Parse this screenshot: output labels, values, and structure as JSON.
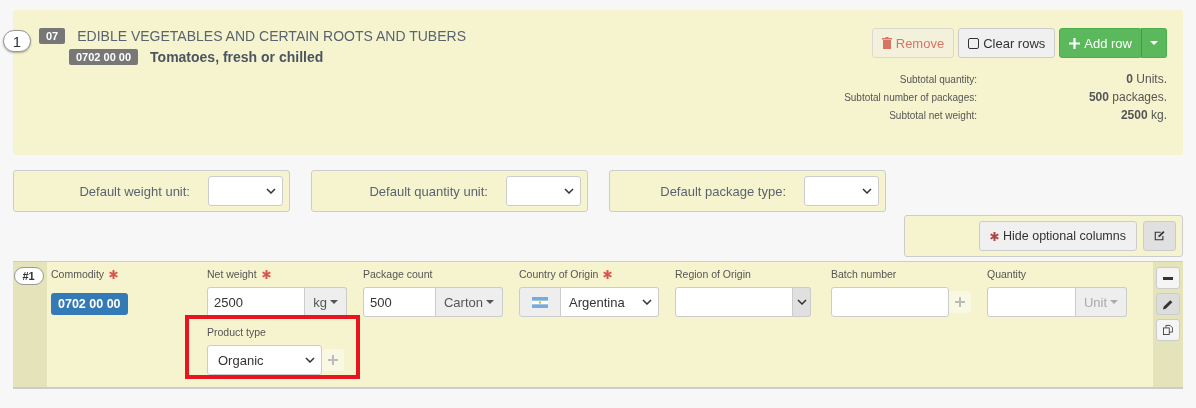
{
  "header": {
    "index": "1",
    "chapter_code": "07",
    "chapter_title": "EDIBLE VEGETABLES AND CERTAIN ROOTS AND TUBERS",
    "commodity_code": "0702 00 00",
    "commodity_title": "Tomatoes, fresh or chilled",
    "buttons": [
      {
        "kind": "remove",
        "label": "Remove",
        "disabled": true
      },
      {
        "kind": "clear",
        "label": "Clear rows",
        "disabled": false
      },
      {
        "kind": "add",
        "label": "Add row",
        "disabled": false
      }
    ],
    "subtotals": [
      {
        "label": "Subtotal quantity:",
        "value": "0",
        "unit": "Units."
      },
      {
        "label": "Subtotal number of packages:",
        "value": "500",
        "unit": "packages."
      },
      {
        "label": "Subtotal net weight:",
        "value": "2500",
        "unit": "kg."
      }
    ]
  },
  "defaults": [
    {
      "label": "Default weight unit:"
    },
    {
      "label": "Default quantity unit:"
    },
    {
      "label": "Default package type:"
    }
  ],
  "optional_button": {
    "label": "Hide optional columns"
  },
  "row": {
    "number": "#1",
    "fields": [
      {
        "kind": "badge",
        "label": "Commodity",
        "required": true,
        "value": "0702 00 00"
      },
      {
        "kind": "addon",
        "label": "Net weight",
        "required": true,
        "value": "2500",
        "addon": "kg",
        "addon_disabled": false
      },
      {
        "kind": "addon",
        "label": "Package count",
        "required": false,
        "value": "500",
        "addon": "Carton",
        "addon_disabled": false
      },
      {
        "kind": "flag",
        "label": "Country of Origin",
        "required": true,
        "value": "Argentina"
      },
      {
        "kind": "combo",
        "label": "Region of Origin",
        "required": false
      },
      {
        "kind": "plus",
        "label": "Batch number",
        "required": false
      },
      {
        "kind": "addon",
        "label": "Quantity",
        "required": false,
        "addon": "Unit",
        "addon_disabled": true
      },
      {
        "kind": "select",
        "label": "Product type",
        "required": false,
        "value": "Organic",
        "highlighted": true
      }
    ]
  }
}
